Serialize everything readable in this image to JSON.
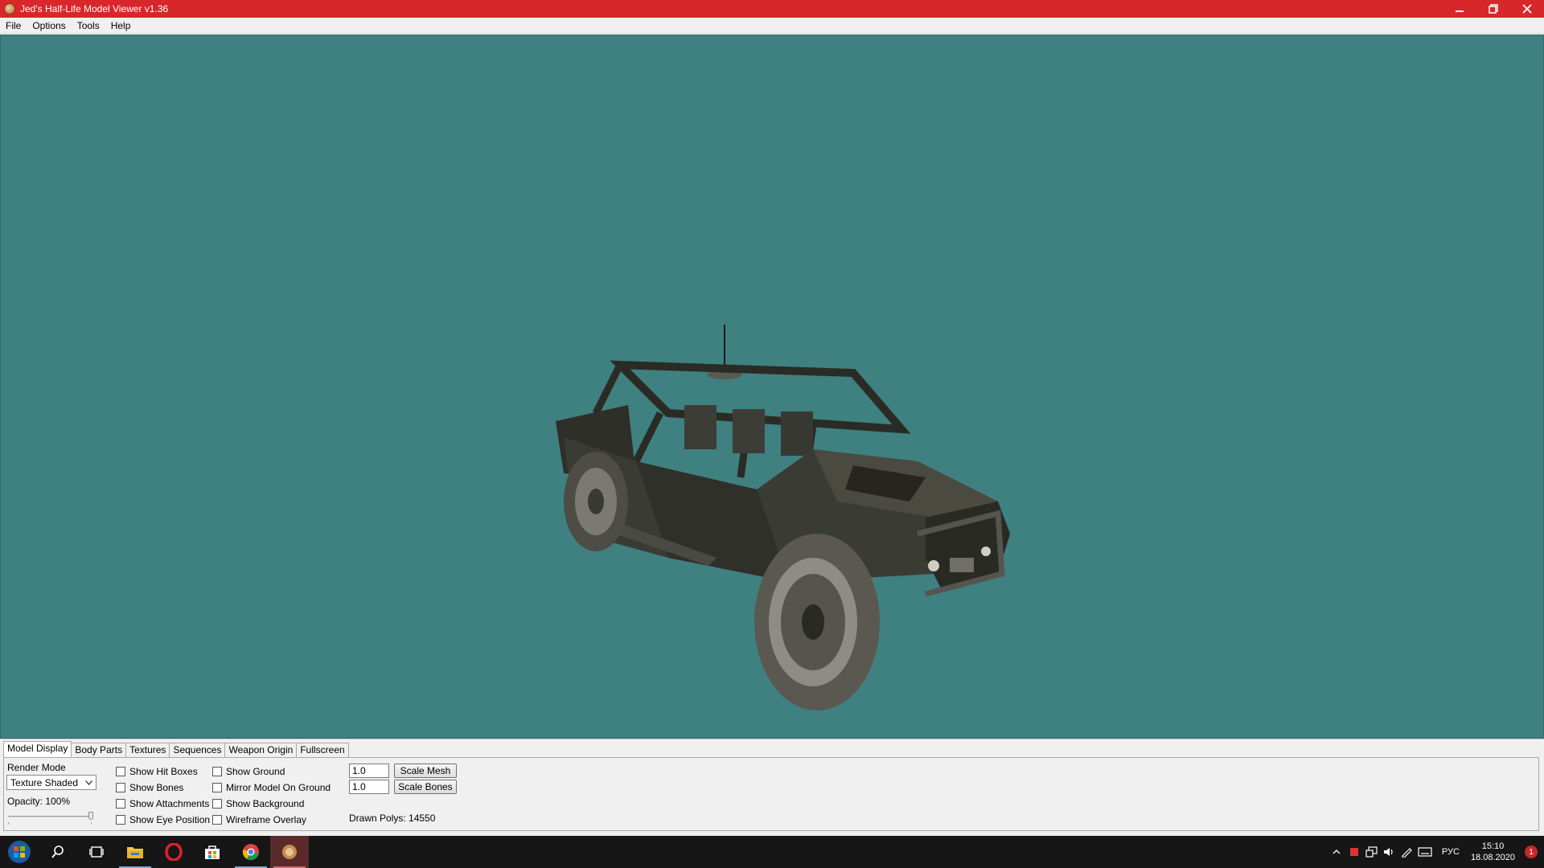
{
  "window": {
    "title": "Jed's Half-Life Model Viewer v1.36"
  },
  "menu": [
    "File",
    "Options",
    "Tools",
    "Help"
  ],
  "tabs": [
    "Model Display",
    "Body Parts",
    "Textures",
    "Sequences",
    "Weapon Origin",
    "Fullscreen"
  ],
  "active_tab": "Model Display",
  "model_display": {
    "render_mode_label": "Render Mode",
    "render_mode_value": "Texture Shaded",
    "opacity_label": "Opacity: 100%",
    "opacity_fraction": 1.0,
    "checkboxes_col1": [
      "Show Hit Boxes",
      "Show Bones",
      "Show Attachments",
      "Show Eye Position"
    ],
    "checkboxes_col2": [
      "Show Ground",
      "Mirror Model On Ground",
      "Show Background",
      "Wireframe Overlay"
    ],
    "scale_mesh_value": "1.0",
    "scale_mesh_button": "Scale Mesh",
    "scale_bones_value": "1.0",
    "scale_bones_button": "Scale Bones",
    "drawn_polys": "Drawn Polys: 14550"
  },
  "viewport": {
    "background_color": "#3f8080"
  },
  "taskbar": {
    "apps": [
      "start-icon",
      "search-icon",
      "task-view-icon",
      "file-explorer-icon",
      "opera-icon",
      "store-icon",
      "chrome-icon",
      "model-viewer-icon"
    ],
    "language": "РУС",
    "time": "15:10",
    "date": "18.08.2020",
    "notification_count": "1"
  }
}
